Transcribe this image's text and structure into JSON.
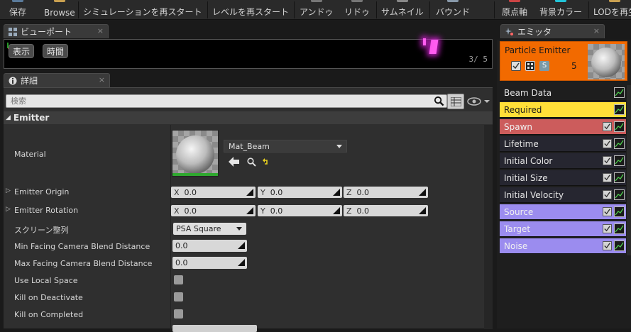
{
  "toolbar": {
    "items": [
      "保存",
      "Browse",
      "シミュレーションを再スタート",
      "レベルを再スタート",
      "アンドゥ",
      "リドゥ",
      "サムネイル",
      "バウンド",
      "原点軸",
      "背景カラー",
      "LODを再生"
    ]
  },
  "tabs": {
    "viewport": "ビューポート",
    "details": "詳細",
    "emitters": "エミッタ",
    "close_glyph": "×"
  },
  "viewport": {
    "buttons": [
      "表示",
      "時間"
    ],
    "counter": "3/ 5"
  },
  "details": {
    "search_placeholder": "検索",
    "section_title": "Emitter",
    "rows": {
      "material": "Material",
      "emitter_origin": "Emitter Origin",
      "emitter_rotation": "Emitter Rotation",
      "screen_alignment": "スクリーン整列",
      "min_facing": "Min Facing Camera Blend Distance",
      "max_facing": "Max Facing Camera Blend Distance",
      "use_local_space": "Use Local Space",
      "kill_on_deactivate": "Kill on Deactivate",
      "kill_on_completed": "Kill on Completed"
    },
    "material_value": "Mat_Beam",
    "origin": {
      "x_label": "X",
      "x": "0.0",
      "y_label": "Y",
      "y": "0.0",
      "z_label": "Z",
      "z": "0.0"
    },
    "rotation": {
      "x_label": "X",
      "x": "0.0",
      "y_label": "Y",
      "y": "0.0",
      "z_label": "Z",
      "z": "0.0"
    },
    "screen_alignment_value": "PSA Square",
    "min_facing_value": "0.0",
    "max_facing_value": "0.0",
    "checkboxes": {
      "use_local_space": false,
      "kill_on_deactivate": false,
      "kill_on_completed": false
    }
  },
  "emitter": {
    "name": "Particle Emitter",
    "count": "5",
    "modules": [
      {
        "label": "Beam Data",
        "color": "#1e1e1e",
        "text": "#e6e6e6",
        "check": false
      },
      {
        "label": "Required",
        "color": "#ffdf38",
        "text": "#1a1a1a",
        "check": false
      },
      {
        "label": "Spawn",
        "color": "#cc5c5c",
        "text": "#f0f0f0",
        "check": true
      },
      {
        "label": "Lifetime",
        "color": "#262630",
        "text": "#e6e6e6",
        "check": true
      },
      {
        "label": "Initial Color",
        "color": "#262630",
        "text": "#e6e6e6",
        "check": true
      },
      {
        "label": "Initial Size",
        "color": "#262630",
        "text": "#e6e6e6",
        "check": true
      },
      {
        "label": "Initial Velocity",
        "color": "#262630",
        "text": "#e6e6e6",
        "check": true
      },
      {
        "label": "Source",
        "color": "#9b8cef",
        "text": "#f0f0f0",
        "check": true
      },
      {
        "label": "Target",
        "color": "#9b8cef",
        "text": "#f0f0f0",
        "check": true
      },
      {
        "label": "Noise",
        "color": "#9b8cef",
        "text": "#f0f0f0",
        "check": true
      }
    ]
  }
}
